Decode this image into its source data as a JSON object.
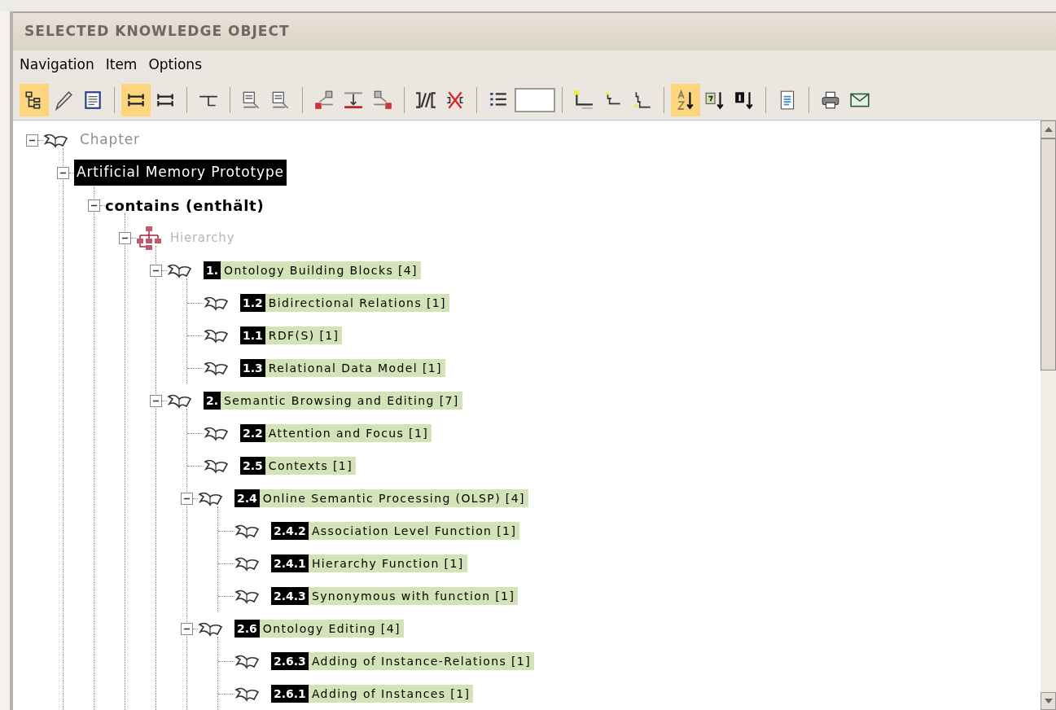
{
  "panel": {
    "title": "SELECTED KNOWLEDGE OBJECT"
  },
  "menu": [
    "Navigation",
    "Item",
    "Options"
  ],
  "toolbar": [
    [
      {
        "kind": "tree",
        "selected": true
      },
      {
        "kind": "pencil",
        "selected": false
      },
      {
        "kind": "form",
        "selected": false
      }
    ],
    [
      {
        "kind": "rows",
        "selected": true
      },
      {
        "kind": "rows",
        "selected": false
      }
    ],
    [
      {
        "kind": "connector",
        "selected": false
      }
    ],
    [
      {
        "kind": "doc-arrow",
        "selected": false
      },
      {
        "kind": "doc-arrow",
        "selected": false
      }
    ],
    [
      {
        "kind": "relate-up",
        "selected": false
      },
      {
        "kind": "relate-down",
        "selected": false
      },
      {
        "kind": "relate-right",
        "selected": false
      }
    ],
    [
      {
        "kind": "link",
        "selected": false
      },
      {
        "kind": "unlink",
        "selected": false
      }
    ],
    [
      {
        "kind": "numbered-list",
        "selected": false
      },
      {
        "kind": "field",
        "selected": false
      }
    ],
    [
      {
        "kind": "level-1",
        "selected": false
      },
      {
        "kind": "level-2",
        "selected": false
      },
      {
        "kind": "level-3",
        "selected": false
      }
    ],
    [
      {
        "kind": "sort-az",
        "selected": true
      },
      {
        "kind": "sort-question",
        "selected": false
      },
      {
        "kind": "sort-number",
        "selected": false
      }
    ],
    [
      {
        "kind": "document",
        "selected": false
      }
    ],
    [
      {
        "kind": "printer",
        "selected": false
      },
      {
        "kind": "mail",
        "selected": false
      }
    ]
  ],
  "tree": [
    {
      "kind": "chapter",
      "label": "Chapter",
      "expanded": true,
      "children": [
        {
          "kind": "root",
          "label": "Artificial Memory Prototype",
          "expanded": true,
          "children": [
            {
              "kind": "relation",
              "label": "contains (enthält)",
              "expanded": true,
              "children": [
                {
                  "kind": "hierarchy",
                  "label": "Hierarchy",
                  "expanded": true,
                  "children": [
                    {
                      "kind": "entry",
                      "number": "1.",
                      "label": "Ontology Building Blocks [4]",
                      "expanded": true,
                      "children": [
                        {
                          "kind": "entry",
                          "number": "1.2",
                          "label": "Bidirectional Relations [1]"
                        },
                        {
                          "kind": "entry",
                          "number": "1.1",
                          "label": "RDF(S) [1]"
                        },
                        {
                          "kind": "entry",
                          "number": "1.3",
                          "label": "Relational Data Model [1]"
                        }
                      ]
                    },
                    {
                      "kind": "entry",
                      "number": "2.",
                      "label": "Semantic Browsing and Editing [7]",
                      "expanded": true,
                      "children": [
                        {
                          "kind": "entry",
                          "number": "2.2",
                          "label": "Attention and Focus [1]"
                        },
                        {
                          "kind": "entry",
                          "number": "2.5",
                          "label": "Contexts [1]"
                        },
                        {
                          "kind": "entry",
                          "number": "2.4",
                          "label": "Online Semantic Processing (OLSP) [4]",
                          "expanded": true,
                          "children": [
                            {
                              "kind": "entry",
                              "number": "2.4.2",
                              "label": "Association Level Function [1]"
                            },
                            {
                              "kind": "entry",
                              "number": "2.4.1",
                              "label": "Hierarchy Function [1]"
                            },
                            {
                              "kind": "entry",
                              "number": "2.4.3",
                              "label": "Synonymous with function [1]"
                            }
                          ]
                        },
                        {
                          "kind": "entry",
                          "number": "2.6",
                          "label": "Ontology Editing [4]",
                          "expanded": true,
                          "children": [
                            {
                              "kind": "entry",
                              "number": "2.6.3",
                              "label": "Adding of Instance-Relations [1]"
                            },
                            {
                              "kind": "entry",
                              "number": "2.6.1",
                              "label": "Adding of Instances [1]"
                            }
                          ]
                        }
                      ]
                    }
                  ]
                }
              ]
            }
          ]
        }
      ]
    }
  ]
}
